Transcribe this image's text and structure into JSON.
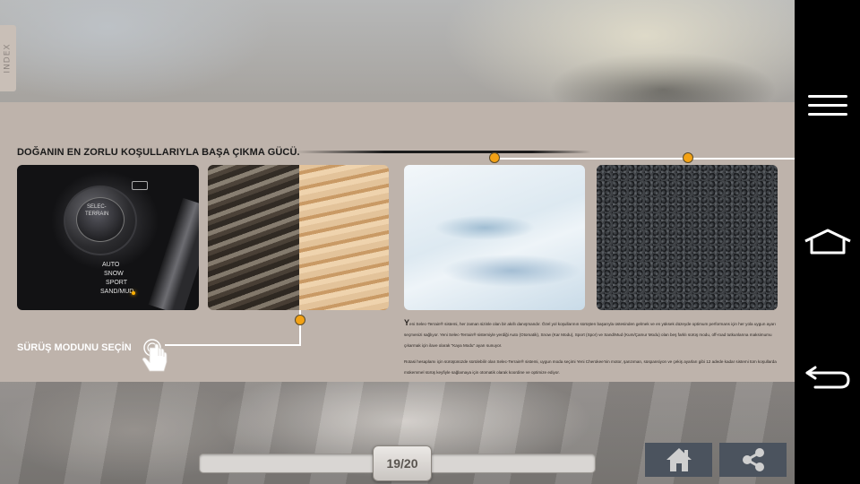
{
  "index_tab": {
    "label": "INDEX"
  },
  "section": {
    "title": "DOĞANIN EN ZORLU KOŞULLARIYLA BAŞA ÇIKMA GÜCÜ."
  },
  "knob": {
    "ring_label_1": "SELEC-",
    "ring_label_2": "TERRAIN",
    "modes": [
      "AUTO",
      "SNOW",
      "SPORT",
      "SAND/MUD"
    ],
    "selected_mode": "SAND/MUD"
  },
  "cta": {
    "label": "SÜRÜŞ MODUNU SEÇİN"
  },
  "description": {
    "drop_cap": "Y",
    "paragraph_1": "eni Selec-Terrain® sistemi, her zaman sizinle olan bir akıllı danışmandır. Özel yol koşullarının sürüşten başarıyla üstesinden gelmek ve en yüksek düzeyde optimum performans için her yola uygun ayarı seçmenizi sağlıyor. Yeni Selec-Terrain® sistemiyle yerdiği Auto (Otomatik), Snow (Kar Modu), Sport (Spor) ve Sand/Mud (Kum/Çamur Modu) olan beş farklı sürüş modu, off-road tutkunlarına maksimumu çıkarmak için ilave olarak \"Kaya Modu\" ayarı sunuyor.",
    "paragraph_2": "Rotasi hesaplamı için sürüşünüzde sürülebilir olan Selec-Terrain® sistemi, uygun moda seçimi Yeni Cherokee'nin motor, şanzıman, süspansiyon ve çekiş ayarları gibi 12 adede kadar sistemi tüm koşullarda mükemmel sürüş keyfiyle sağlamaya için otomatik olarak koordine ve optimize ediyor."
  },
  "pager": {
    "current": 19,
    "total": 20,
    "label": "19/20"
  },
  "buttons": {
    "home": "home-icon",
    "share": "share-icon"
  },
  "nav": {
    "menu": "menu-icon",
    "home": "home-outline-icon",
    "back": "back-icon"
  },
  "colors": {
    "panel": "#beb3ab",
    "accent_dot": "#f3a215",
    "button_bg": "#4b535e",
    "navbar": "#000000"
  }
}
